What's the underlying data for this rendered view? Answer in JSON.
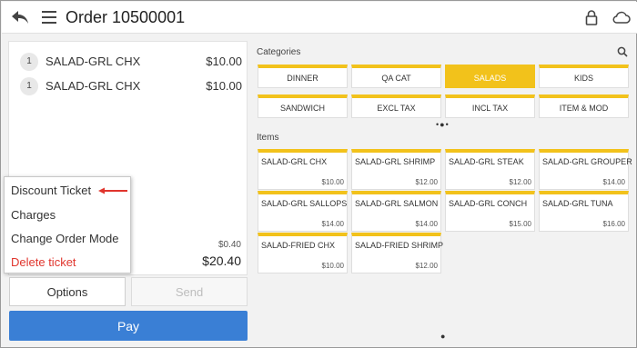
{
  "header": {
    "title": "Order 10500001",
    "back_icon": "back-arrow-icon",
    "menu_icon": "hamburger-menu-icon",
    "lock_icon": "lock-icon",
    "cloud_icon": "cloud-icon"
  },
  "ticket": {
    "lines": [
      {
        "qty": "1",
        "name": "SALAD-GRL CHX",
        "price": "$10.00"
      },
      {
        "qty": "1",
        "name": "SALAD-GRL CHX",
        "price": "$10.00"
      }
    ],
    "tax": "$0.40",
    "total": "$20.40"
  },
  "popup_menu": {
    "items": [
      "Discount Ticket",
      "Charges",
      "Change Order Mode",
      "Delete ticket"
    ],
    "danger_color": "#e0352d"
  },
  "buttons": {
    "options": "Options",
    "send": "Send",
    "pay": "Pay"
  },
  "categories": {
    "label": "Categories",
    "items": [
      "DINNER",
      "QA CAT",
      "SALADS",
      "KIDS",
      "SANDWICH",
      "EXCL TAX",
      "INCL TAX",
      "ITEM & MOD"
    ],
    "selected": "SALADS"
  },
  "items": {
    "label": "Items",
    "list": [
      {
        "name": "SALAD-GRL CHX",
        "price": "$10.00"
      },
      {
        "name": "SALAD-GRL SHRIMP",
        "price": "$12.00"
      },
      {
        "name": "SALAD-GRL STEAK",
        "price": "$12.00"
      },
      {
        "name": "SALAD-GRL GROUPER",
        "price": "$14.00"
      },
      {
        "name": "SALAD-GRL SALLOPS",
        "price": "$14.00"
      },
      {
        "name": "SALAD-GRL SALMON",
        "price": "$14.00"
      },
      {
        "name": "SALAD-GRL CONCH",
        "price": "$15.00"
      },
      {
        "name": "SALAD-GRL TUNA",
        "price": "$16.00"
      },
      {
        "name": "SALAD-FRIED CHX",
        "price": "$10.00"
      },
      {
        "name": "SALAD-FRIED SHRIMP",
        "price": "$12.00"
      }
    ]
  },
  "colors": {
    "accent_yellow": "#f2c21b",
    "pay_blue": "#3a7fd5"
  }
}
